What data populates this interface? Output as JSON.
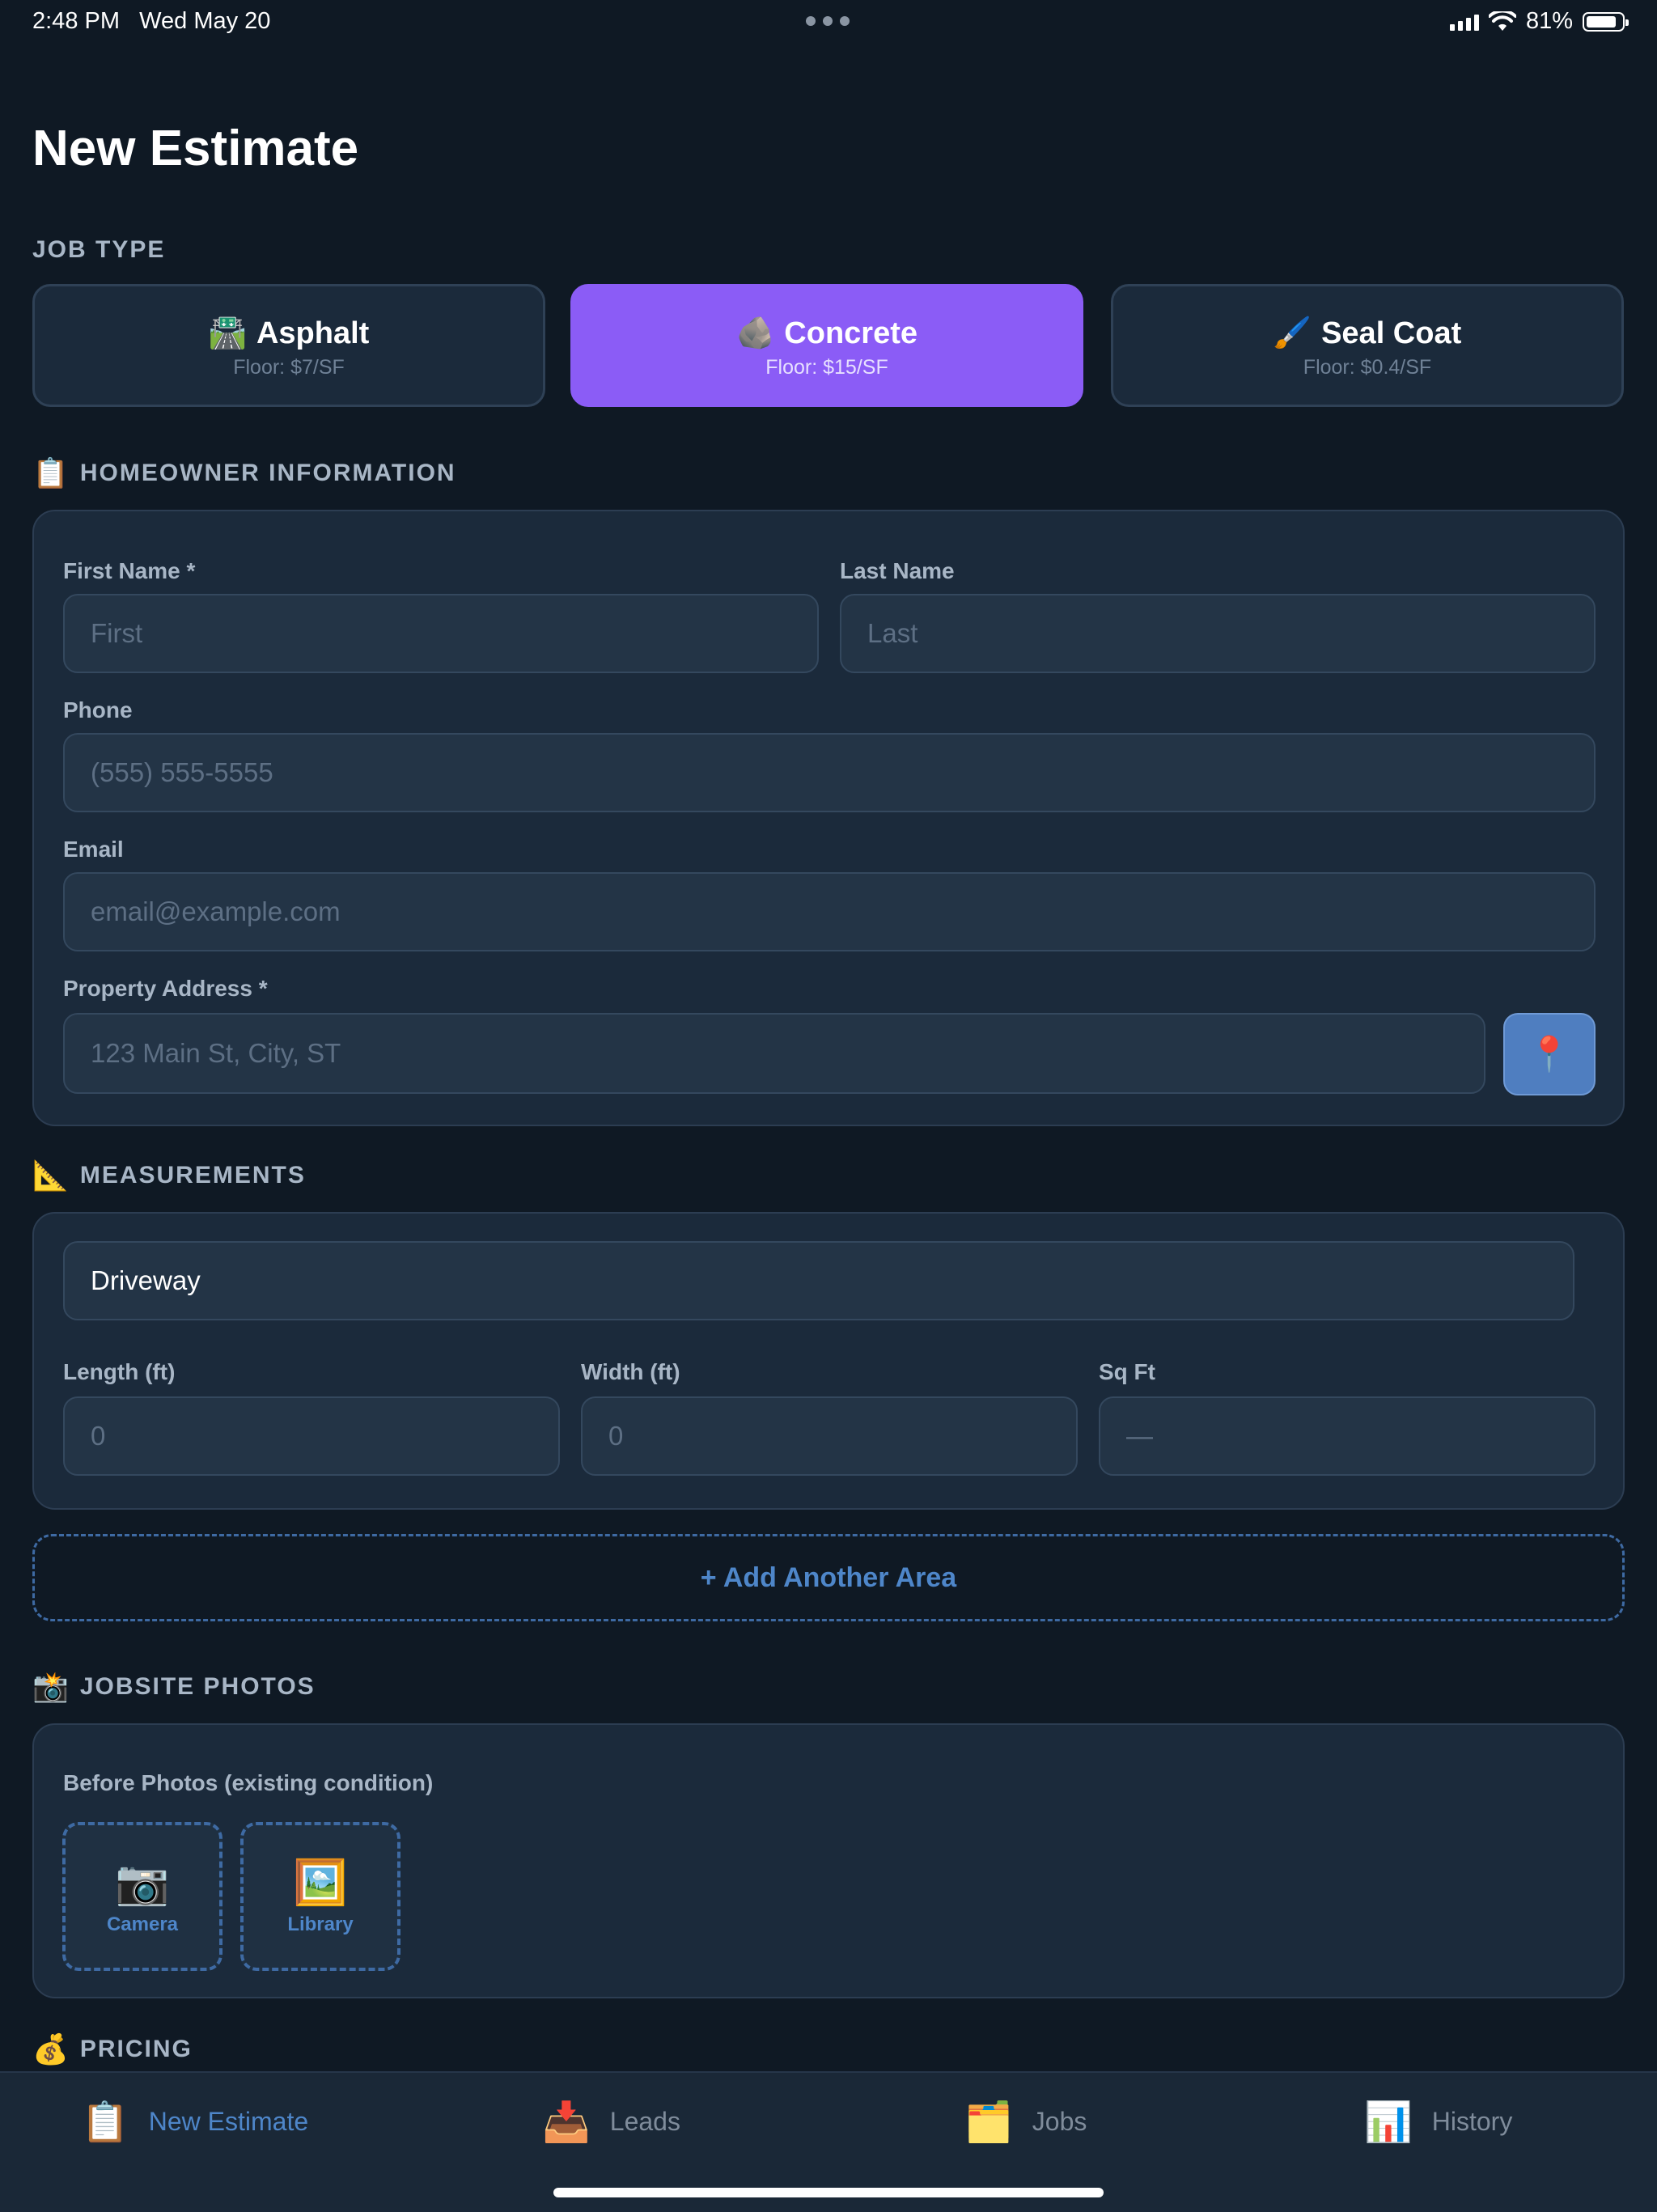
{
  "status_bar": {
    "time": "2:48 PM",
    "date": "Wed May 20",
    "battery": "81%"
  },
  "page_title": "New Estimate",
  "job_type": {
    "section": "JOB TYPE",
    "options": [
      {
        "icon": "🛣️",
        "label": "Asphalt",
        "floor": "Floor: $7/SF",
        "selected": false
      },
      {
        "icon": "🪨",
        "label": "Concrete",
        "floor": "Floor: $15/SF",
        "selected": true
      },
      {
        "icon": "🖌️",
        "label": "Seal Coat",
        "floor": "Floor: $0.4/SF",
        "selected": false
      }
    ]
  },
  "homeowner": {
    "section_icon": "📋",
    "section": "HOMEOWNER INFORMATION",
    "first_name": {
      "label": "First Name *",
      "placeholder": "First"
    },
    "last_name": {
      "label": "Last Name",
      "placeholder": "Last"
    },
    "phone": {
      "label": "Phone",
      "placeholder": "(555) 555-5555"
    },
    "email": {
      "label": "Email",
      "placeholder": "email@example.com"
    },
    "address": {
      "label": "Property Address *",
      "placeholder": "123 Main St, City, ST",
      "pin_icon": "📍"
    }
  },
  "measurements": {
    "section_icon": "📐",
    "section": "MEASUREMENTS",
    "area_name": "Driveway",
    "length": {
      "label": "Length (ft)",
      "placeholder": "0"
    },
    "width": {
      "label": "Width (ft)",
      "placeholder": "0"
    },
    "sqft": {
      "label": "Sq Ft",
      "value": "—"
    },
    "add_area": "+ Add Another Area"
  },
  "photos": {
    "section_icon": "📸",
    "section": "JOBSITE PHOTOS",
    "before_label": "Before Photos (existing condition)",
    "camera": {
      "icon": "📷",
      "label": "Camera"
    },
    "library": {
      "icon": "🖼️",
      "label": "Library"
    }
  },
  "pricing": {
    "section_icon": "💰",
    "section": "PRICING"
  },
  "tabs": [
    {
      "icon": "📋",
      "label": "New Estimate",
      "active": true
    },
    {
      "icon": "📥",
      "label": "Leads",
      "active": false
    },
    {
      "icon": "🗂️",
      "label": "Jobs",
      "active": false
    },
    {
      "icon": "📊",
      "label": "History",
      "active": false
    }
  ],
  "colors": {
    "background": "#0f1924",
    "card": "#1b2a3b",
    "accent": "#8b5cf6",
    "link": "#4e86c9"
  }
}
